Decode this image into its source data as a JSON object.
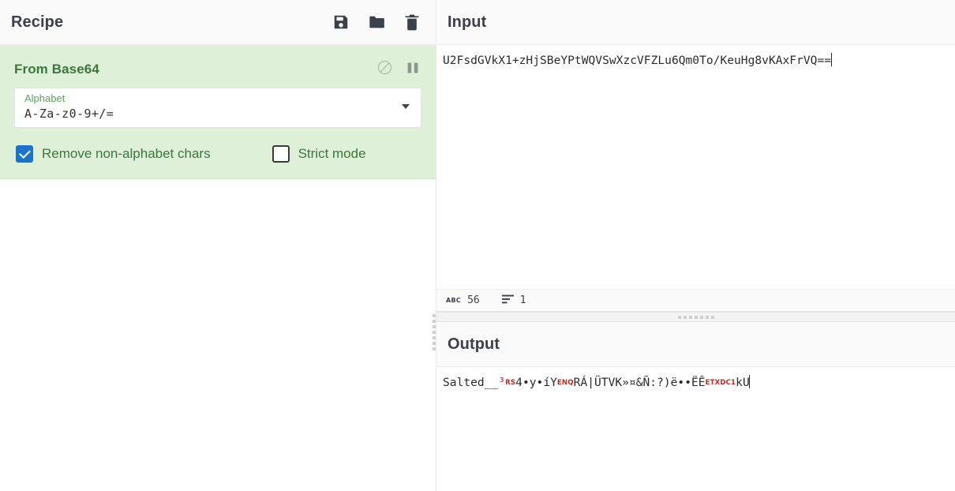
{
  "recipe": {
    "title": "Recipe",
    "controls": [
      {
        "name": "save-recipe-button",
        "icon": "save-icon"
      },
      {
        "name": "load-recipe-button",
        "icon": "folder-icon"
      },
      {
        "name": "clear-recipe-button",
        "icon": "trash-icon"
      }
    ],
    "operations": [
      {
        "name": "From Base64",
        "icons": [
          {
            "name": "disable-operation-icon",
            "icon": "circle-slash-icon"
          },
          {
            "name": "pause-breakpoint-icon",
            "icon": "pause-icon"
          }
        ],
        "args": {
          "alphabet_label": "Alphabet",
          "alphabet_value": "A-Za-z0-9+/=",
          "remove_non_alphabet_label": "Remove non-alphabet chars",
          "remove_non_alphabet_checked": true,
          "strict_mode_label": "Strict mode",
          "strict_mode_checked": false
        }
      }
    ]
  },
  "input": {
    "title": "Input",
    "value": "U2FsdGVkX1+zHjSBeYPtWQVSwXzcVFZLu6Qm0To/KeuHg8vKAxFrVQ==",
    "status": {
      "length_icon": "abc-icon",
      "length_label": "ABC",
      "length": "56",
      "lines_icon": "lines-icon",
      "lines": "1"
    }
  },
  "output": {
    "title": "Output",
    "segments": [
      {
        "text": "Salted__",
        "kind": "plain"
      },
      {
        "text": "³",
        "kind": "red"
      },
      {
        "text": "RS",
        "kind": "control"
      },
      {
        "text": "4•y•íY",
        "kind": "plain"
      },
      {
        "text": "ENQ",
        "kind": "control"
      },
      {
        "text": "RÁ|ÜTVK»¤&Ñ:?)ë••ËÊ",
        "kind": "plain"
      },
      {
        "text": "ETX",
        "kind": "control"
      },
      {
        "text": "DC1",
        "kind": "control"
      },
      {
        "text": "kU",
        "kind": "plain"
      }
    ]
  },
  "colors": {
    "operation_bg": "#dff0d8",
    "operation_title": "#3c763d",
    "checkbox_on": "#1a73c9",
    "control_char": "#c7251e",
    "pane_title": "#3a4149"
  }
}
